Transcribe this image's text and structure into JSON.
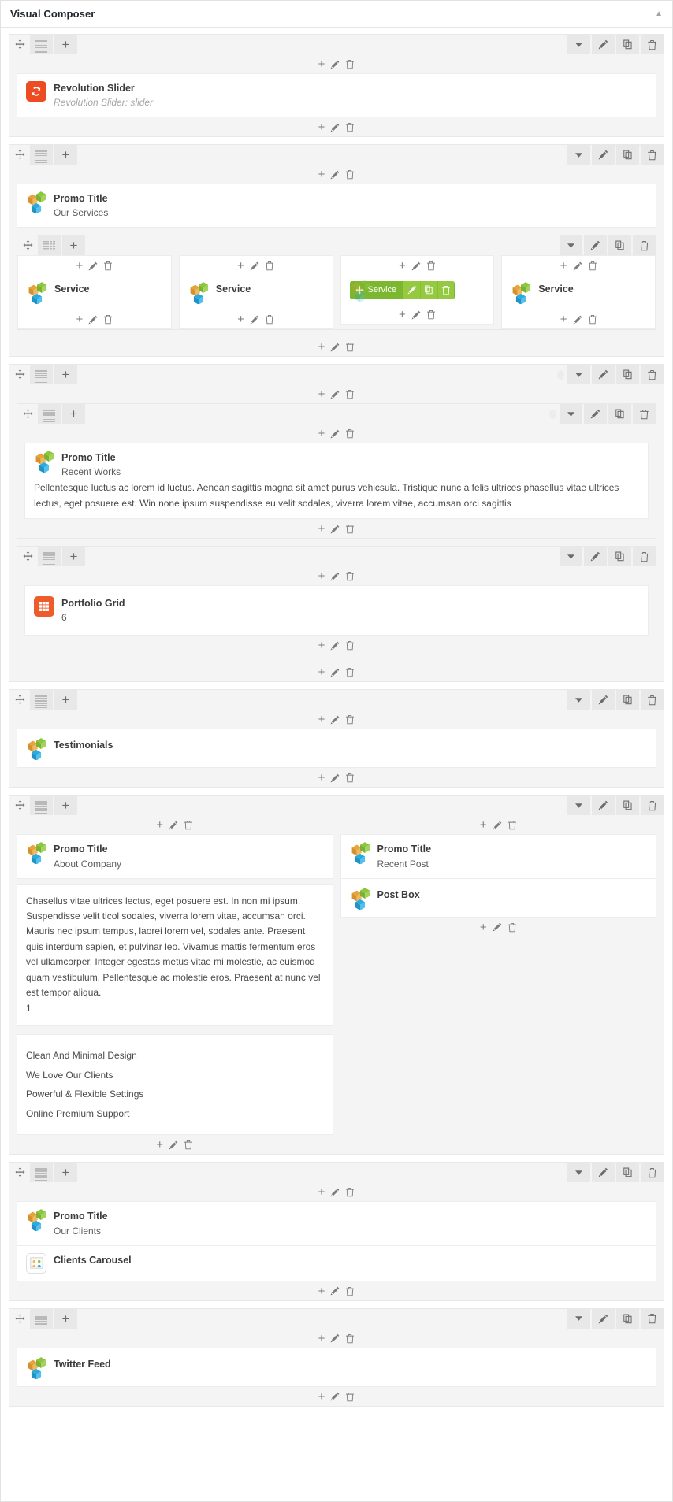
{
  "meta": {
    "app_title": "Visual Composer",
    "toggle_indicator": "▲"
  },
  "icons": {
    "move": "move-icon",
    "layout": "layout-icon",
    "add": "+",
    "edit": "pencil-icon",
    "clone": "clone-icon",
    "delete": "trash-icon",
    "chevron_down": "▼"
  },
  "rows": [
    {
      "id": "row-slider",
      "layout_icon": "row-layout-full",
      "elements": [
        {
          "name": "revolution-slider",
          "icon": "revolution-slider-icon",
          "title": "Revolution Slider",
          "subtitle": "Revolution Slider: slider",
          "subtitle_style": "italic"
        }
      ]
    },
    {
      "id": "row-services",
      "layout_icon": "row-layout-full",
      "elements": [
        {
          "name": "promo-title-our-services",
          "icon": "wpb-cube-icon",
          "title": "Promo Title",
          "subtitle": "Our Services"
        }
      ],
      "nested_row": {
        "id": "row-services-columns",
        "layout_icon": "row-layout-4col",
        "columns": [
          {
            "name": "service-1",
            "icon": "wpb-cube-icon",
            "title": "Service",
            "state": "normal"
          },
          {
            "name": "service-2",
            "icon": "wpb-cube-icon",
            "title": "Service",
            "state": "normal"
          },
          {
            "name": "service-3",
            "icon": "wpb-cube-icon",
            "title": "Service",
            "state": "hover",
            "hover_label": "Service"
          },
          {
            "name": "service-4",
            "icon": "wpb-cube-icon",
            "title": "Service",
            "state": "normal"
          }
        ]
      }
    },
    {
      "id": "row-recent-works",
      "layout_icon": "row-layout-full",
      "has_dot_handle": true,
      "inner_rows": [
        {
          "id": "row-recent-works-text",
          "layout_icon": "row-layout-full",
          "has_dot_handle": true,
          "elements": [
            {
              "name": "promo-title-recent-works",
              "icon": "wpb-cube-icon",
              "title": "Promo Title",
              "subtitle": "Recent Works",
              "paragraph": "Pellentesque luctus ac lorem id luctus. Aenean sagittis magna sit amet purus vehicsula. Tristique nunc a felis ultrices phasellus vitae ultrices lectus, eget posuere est. Win none ipsum suspendisse eu velit sodales, viverra lorem vitae, accumsan orci sagittis"
            }
          ]
        },
        {
          "id": "row-portfolio-grid",
          "layout_icon": "row-layout-full",
          "elements": [
            {
              "name": "portfolio-grid",
              "icon": "portfolio-grid-icon",
              "title": "Portfolio Grid",
              "subtitle": "6"
            }
          ]
        }
      ]
    },
    {
      "id": "row-testimonials",
      "layout_icon": "row-layout-full",
      "elements": [
        {
          "name": "testimonials",
          "icon": "wpb-cube-icon",
          "title": "Testimonials"
        }
      ]
    },
    {
      "id": "row-about",
      "layout_icon": "row-layout-full",
      "two_columns": {
        "left": {
          "name": "column-about-company",
          "elements": [
            {
              "name": "promo-title-about-company",
              "icon": "wpb-cube-icon",
              "title": "Promo Title",
              "subtitle": "About Company"
            },
            {
              "name": "about-company-text",
              "paragraph": "Chasellus vitae ultrices lectus, eget posuere est. In non mi ipsum. Suspendisse velit ticol sodales, viverra lorem vitae, accumsan orci. Mauris nec ipsum tempus, laorei lorem vel, sodales ante. Praesent quis interdum sapien, et pulvinar leo. Vivamus mattis fermentum eros vel ullamcorper. Integer egestas metus vitae mi molestie, ac euismod quam vestibulum. Pellentesque ac molestie eros. Praesent at nunc vel est tempor aliqua.",
              "count": "1"
            },
            {
              "name": "about-company-list",
              "lines": [
                "Clean And Minimal Design",
                "We Love Our Clients",
                "Powerful & Flexible Settings",
                "Online Premium Support"
              ]
            }
          ]
        },
        "right": {
          "name": "column-recent-post",
          "elements": [
            {
              "name": "promo-title-recent-post",
              "icon": "wpb-cube-icon",
              "title": "Promo Title",
              "subtitle": "Recent Post"
            },
            {
              "name": "post-box",
              "icon": "wpb-cube-icon",
              "title": "Post Box"
            }
          ]
        }
      }
    },
    {
      "id": "row-clients",
      "layout_icon": "row-layout-full",
      "elements": [
        {
          "name": "promo-title-our-clients",
          "icon": "wpb-cube-icon",
          "title": "Promo Title",
          "subtitle": "Our Clients"
        },
        {
          "name": "clients-carousel",
          "icon": "clients-carousel-icon",
          "title": "Clients Carousel"
        }
      ]
    },
    {
      "id": "row-twitter",
      "layout_icon": "row-layout-full",
      "elements": [
        {
          "name": "twitter-feed",
          "icon": "wpb-cube-icon",
          "title": "Twitter Feed"
        }
      ]
    }
  ],
  "colors": {
    "hover_green": "#7cb82f",
    "hover_green_light": "#95c93f",
    "revolution_orange": "#ed4b22",
    "portfolio_orange": "#ed5c2a",
    "row_bg": "#f4f4f4",
    "element_bg": "#ffffff"
  }
}
